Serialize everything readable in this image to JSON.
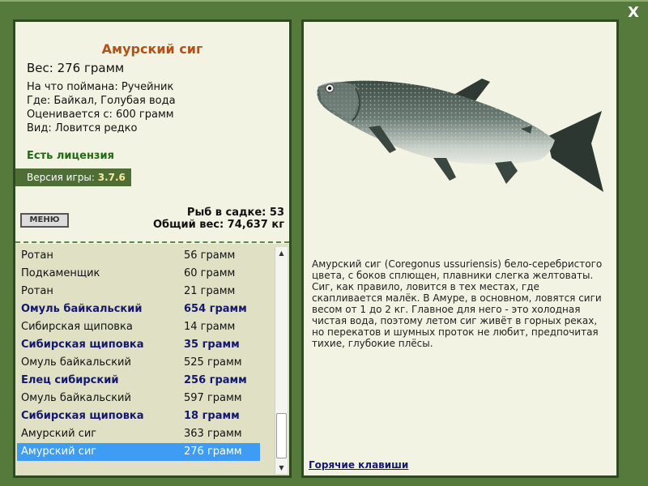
{
  "window": {
    "close_label": "X"
  },
  "fish": {
    "name": "Амурский сиг",
    "weight": "Вес: 276 грамм",
    "caught_on": "На что поймана: Ручейник",
    "location": "Где: Байкал, Голубая вода",
    "valued_from": "Оценивается с: 600 грамм",
    "rarity": "Вид: Ловится редко"
  },
  "license": "Есть лицензия",
  "version": {
    "label": "Версия игры: ",
    "value": "3.7.6"
  },
  "menu_label": "МЕНЮ",
  "stats": {
    "fish_in_cage": "Рыб в садке: 53",
    "total_weight": "Общий вес: 74,637 кг"
  },
  "catch_list": [
    {
      "name": "Ротан",
      "weight": "56 грамм",
      "bold": false
    },
    {
      "name": "Подкаменщик",
      "weight": "60 грамм",
      "bold": false
    },
    {
      "name": "Ротан",
      "weight": "21 грамм",
      "bold": false
    },
    {
      "name": "Омуль байкальский",
      "weight": "654 грамм",
      "bold": true
    },
    {
      "name": "Сибирская щиповка",
      "weight": "14 грамм",
      "bold": false
    },
    {
      "name": "Сибирская щиповка",
      "weight": "35 грамм",
      "bold": true
    },
    {
      "name": "Омуль байкальский",
      "weight": "525 грамм",
      "bold": false
    },
    {
      "name": "Елец сибирский",
      "weight": "256 грамм",
      "bold": true
    },
    {
      "name": "Омуль байкальский",
      "weight": "597 грамм",
      "bold": false
    },
    {
      "name": "Сибирская щиповка",
      "weight": "18 грамм",
      "bold": true
    },
    {
      "name": "Амурский сиг",
      "weight": "363 грамм",
      "bold": false
    },
    {
      "name": "Амурский сиг",
      "weight": "276 грамм",
      "bold": false,
      "selected": true
    }
  ],
  "description": "Амурский сиг (Coregonus ussuriensis) бело-серебристого цвета, с боков сплющен, плавники слегка желтоваты. Сиг, как правило, ловится в тех местах, где скапливается малёк. В Амуре, в основном, ловятся сиги весом от 1 до 2 кг. Главное для него - это холодная чистая вода, поэтому летом сиг живёт в горных реках, но перекатов и шумных проток не любит, предпочитая тихие, глубокие плёсы.",
  "hotkeys_label": "Горячие клавиши",
  "colors": {
    "background": "#557a3c",
    "panel": "#f3f3e3",
    "title": "#b0521a",
    "license": "#1f6a14",
    "bold_row": "#14186e",
    "selected_row": "#3f9cf4"
  },
  "icons": {
    "close": "close-icon",
    "scroll_up": "arrow-up-icon",
    "scroll_down": "arrow-down-icon",
    "fish": "fish-illustration"
  }
}
